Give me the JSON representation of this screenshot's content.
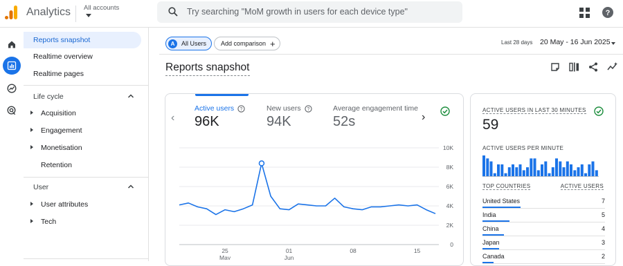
{
  "app": {
    "title": "Analytics",
    "account": "All accounts",
    "logo_colors": [
      "#f9ab00",
      "#e37400"
    ]
  },
  "search": {
    "placeholder": "Try searching \"MoM growth in users for each device type\""
  },
  "icons": {
    "search": "search-icon",
    "apps": "apps-grid-icon",
    "help": "help-icon",
    "rail": [
      "home-icon",
      "reports-icon",
      "explore-icon",
      "advertising-icon"
    ]
  },
  "sidebar": {
    "items": [
      {
        "label": "Reports snapshot",
        "active": true
      },
      {
        "label": "Realtime overview"
      },
      {
        "label": "Realtime pages"
      }
    ],
    "lifecycle": {
      "title": "Life cycle",
      "items": [
        {
          "label": "Acquisition",
          "expandable": true
        },
        {
          "label": "Engagement",
          "expandable": true
        },
        {
          "label": "Monetisation",
          "expandable": true
        },
        {
          "label": "Retention",
          "expandable": false
        }
      ]
    },
    "user": {
      "title": "User",
      "items": [
        {
          "label": "User attributes",
          "expandable": true
        },
        {
          "label": "Tech",
          "expandable": true
        }
      ]
    }
  },
  "toolbar": {
    "segment_chip": {
      "letter": "A",
      "label": "All Users"
    },
    "add_comparison": "Add comparison",
    "date_label": "Last 28 days",
    "date_range": "20 May - 16 Jun 2025"
  },
  "page_title": "Reports snapshot",
  "metrics": [
    {
      "label": "Active users",
      "value": "96K",
      "active": true
    },
    {
      "label": "New users",
      "value": "94K"
    },
    {
      "label": "Average engagement time per active user",
      "value": "52s"
    }
  ],
  "chart_data": {
    "type": "line",
    "series": [
      {
        "values": [
          4100,
          4300,
          3900,
          3700,
          3100,
          3600,
          3400,
          3700,
          4100,
          8400,
          5000,
          3700,
          3600,
          4200,
          4100,
          4000,
          4000,
          4800,
          3900,
          3700,
          3600,
          3900,
          3900,
          4000,
          4100,
          4000,
          4100,
          3600,
          3200
        ]
      }
    ],
    "x_ticks": [
      {
        "index": 5,
        "day": "25",
        "month": "May"
      },
      {
        "index": 12,
        "day": "01",
        "month": "Jun"
      },
      {
        "index": 19,
        "day": "08",
        "month": ""
      },
      {
        "index": 26,
        "day": "15",
        "month": ""
      }
    ],
    "y_ticks": [
      "0",
      "2K",
      "4K",
      "6K",
      "8K",
      "10K"
    ],
    "ylim": [
      0,
      10000
    ],
    "highlight_index": 9,
    "grid": true,
    "color": "#1a73e8"
  },
  "realtime": {
    "title": "ACTIVE USERS IN LAST 30 MINUTES",
    "value": "59",
    "per_minute_title": "ACTIVE USERS PER MINUTE",
    "per_minute_chart": {
      "type": "bar",
      "values": [
        7,
        6,
        5,
        1,
        4,
        4,
        1,
        3,
        4,
        3,
        4,
        2,
        3,
        6,
        6,
        2,
        4,
        5,
        1,
        3,
        6,
        5,
        3,
        5,
        4,
        2,
        3,
        4,
        1,
        4,
        5,
        2
      ]
    },
    "countries_header": "TOP COUNTRIES",
    "users_header": "ACTIVE USERS",
    "countries": [
      {
        "name": "United States",
        "value": 7
      },
      {
        "name": "India",
        "value": 5
      },
      {
        "name": "China",
        "value": 4
      },
      {
        "name": "Japan",
        "value": 3
      },
      {
        "name": "Canada",
        "value": 2
      }
    ]
  }
}
